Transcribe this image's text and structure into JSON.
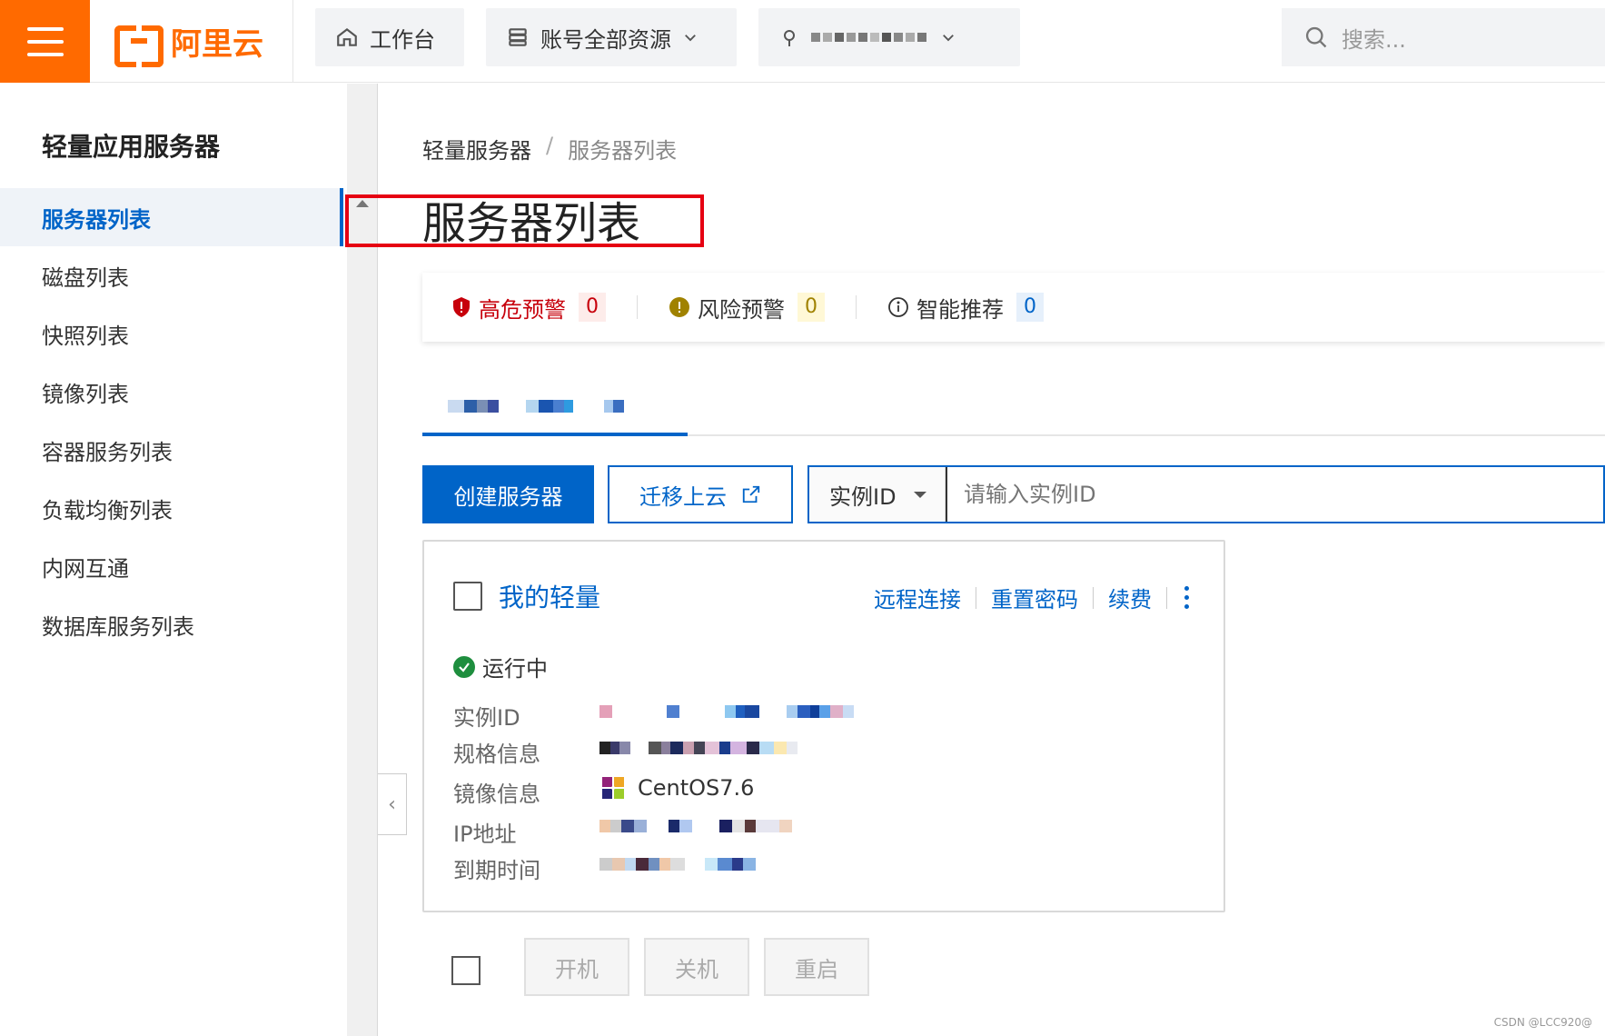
{
  "topbar": {
    "logo_text": "阿里云",
    "workbench_label": "工作台",
    "resources_label": "账号全部资源",
    "search_placeholder": "搜索..."
  },
  "sidebar": {
    "title": "轻量应用服务器",
    "items": [
      {
        "label": "服务器列表",
        "active": true
      },
      {
        "label": "磁盘列表"
      },
      {
        "label": "快照列表"
      },
      {
        "label": "镜像列表"
      },
      {
        "label": "容器服务列表"
      },
      {
        "label": "负载均衡列表"
      },
      {
        "label": "内网互通"
      },
      {
        "label": "数据库服务列表"
      }
    ]
  },
  "main": {
    "breadcrumb": {
      "root": "轻量服务器",
      "separator": "/",
      "current": "服务器列表"
    },
    "page_title": "服务器列表",
    "alerts": [
      {
        "label": "高危预警",
        "count": "0",
        "color": "#c7000b"
      },
      {
        "label": "风险预警",
        "count": "0",
        "color": "#333333"
      },
      {
        "label": "智能推荐",
        "count": "0",
        "color": "#333333"
      }
    ],
    "buttons": {
      "create": "创建服务器",
      "migrate": "迁移上云"
    },
    "search": {
      "select_value": "实例ID",
      "placeholder": "请输入实例ID"
    },
    "card": {
      "name": "我的轻量",
      "actions": {
        "remote": "远程连接",
        "reset_pwd": "重置密码",
        "renew": "续费"
      },
      "status": "运行中",
      "rows": {
        "instance_id_label": "实例ID",
        "spec_label": "规格信息",
        "image_label": "镜像信息",
        "image_value": "CentOS7.6",
        "ip_label": "IP地址",
        "expire_label": "到期时间"
      }
    },
    "bulk": {
      "start": "开机",
      "stop": "关机",
      "restart": "重启"
    }
  },
  "colors": {
    "brand_orange": "#ff6a00",
    "primary_blue": "#0064c8",
    "highlight_red": "#e60012",
    "running_green": "#1e8e3e"
  },
  "watermark": "CSDN @LCC920@"
}
